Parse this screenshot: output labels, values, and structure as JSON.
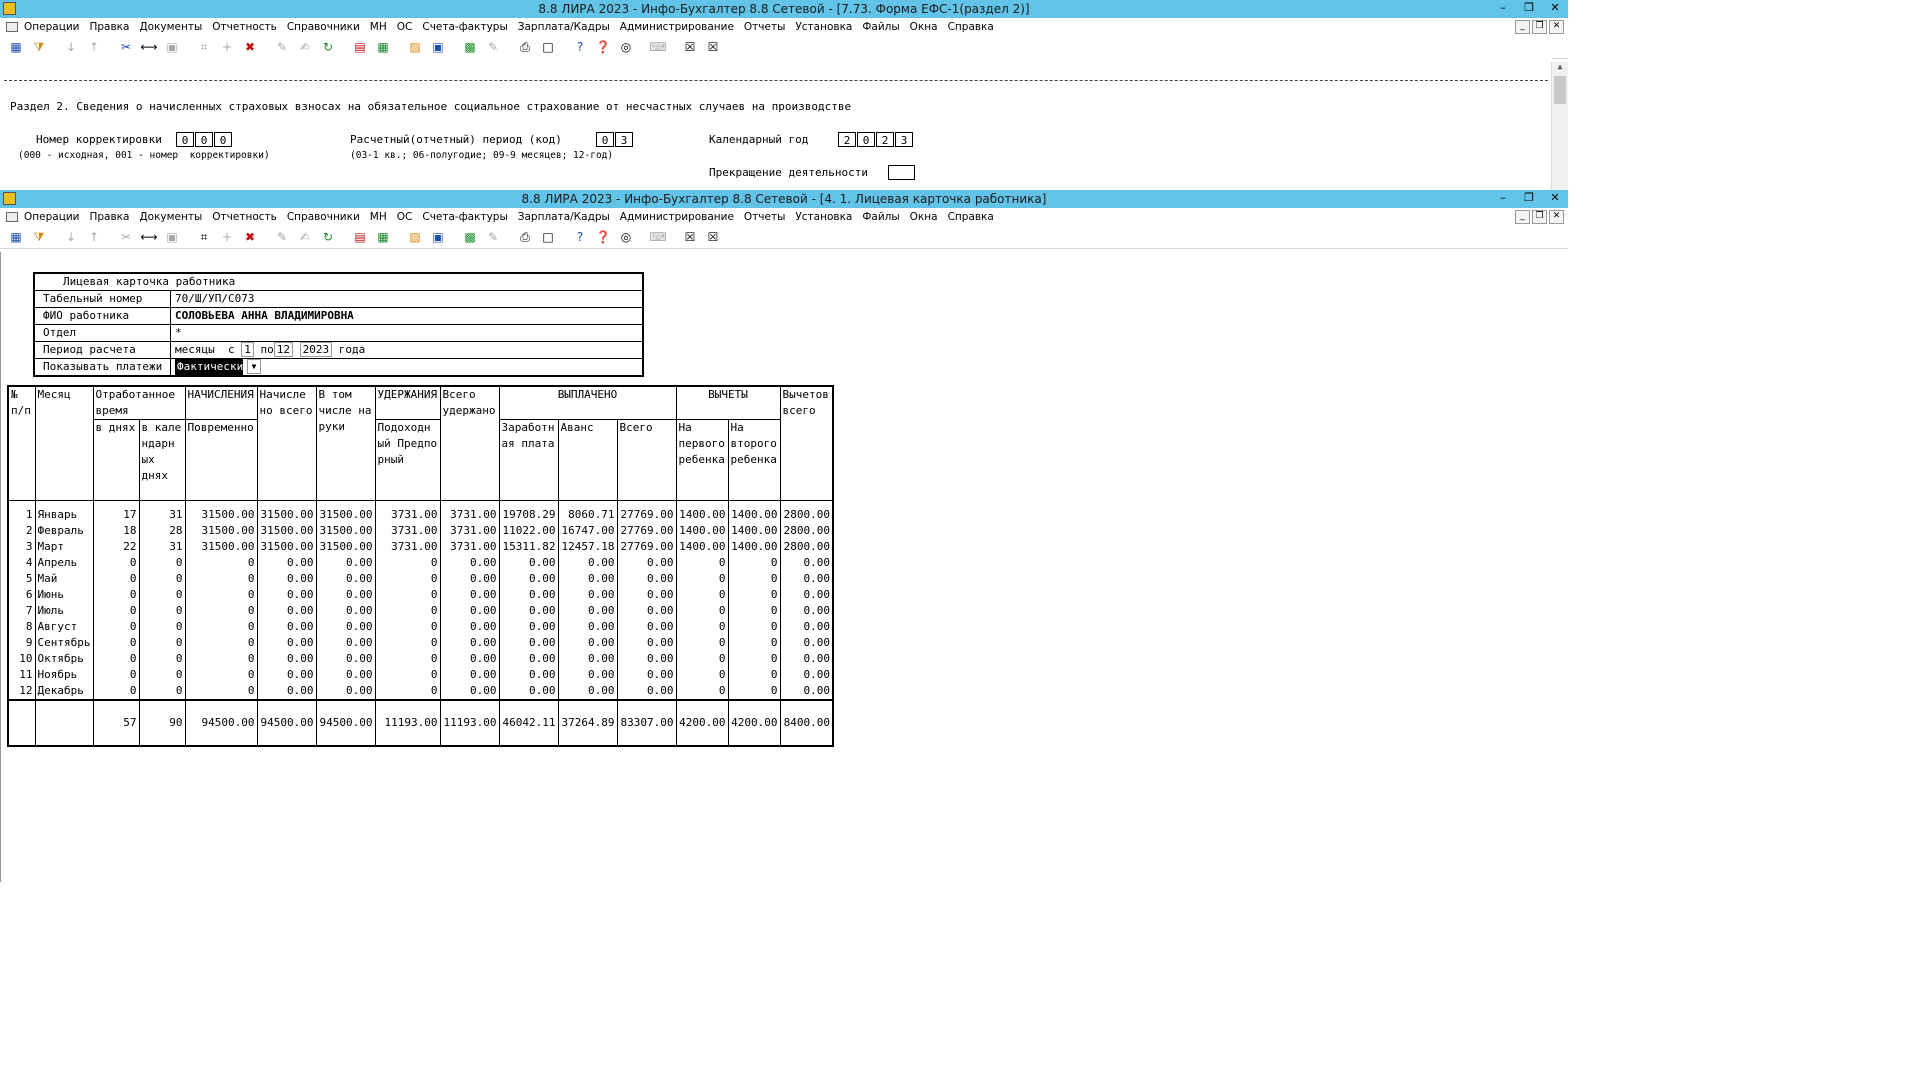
{
  "top_window": {
    "title": "8.8 ЛИРА 2023 - Инфо-Бухгалтер 8.8 Сетевой - [7.73.    Форма ЕФС-1(раздел 2)]",
    "section_heading": "Раздел 2. Сведения о начисленных страховых взносах на обязательное социальное страхование от несчастных случаев на производстве",
    "correction_label": "Номер корректировки",
    "correction_digits": [
      "0",
      "0",
      "0"
    ],
    "correction_hint": "(000 - исходная, 001 - номер  корректировки)",
    "period_label": "Расчетный(отчетный) период (код)",
    "period_digits": [
      "0",
      "3"
    ],
    "period_hint": "(03-1 кв.; 06-полугодие; 09-9 месяцев; 12-год)",
    "year_label": "Календарный год",
    "year_digits": [
      "2",
      "0",
      "2",
      "3"
    ],
    "termination_label": "Прекращение деятельности"
  },
  "main_window": {
    "title": "8.8 ЛИРА 2023 - Инфо-Бухгалтер 8.8 Сетевой - [4. 1. Лицевая карточка работника]"
  },
  "menu": [
    "Операции",
    "Правка",
    "Документы",
    "Отчетность",
    "Справочники",
    "МН",
    "ОС",
    "Счета-фактуры",
    "Зарплата/Кадры",
    "Администрирование",
    "Отчеты",
    "Установка",
    "Файлы",
    "Окна",
    "Справка"
  ],
  "card": {
    "title": "Лицевая карточка работника",
    "tab_label": "Табельный номер",
    "tab_value": "70/Ш/УП/С073",
    "fio_label": "ФИО работника",
    "fio_value": "СОЛОВЬЕВА АННА ВЛАДИМИРОВНА",
    "dept_label": "Отдел",
    "dept_value": "*",
    "period_label": "Период расчета",
    "period_months": "месяцы",
    "period_from_word": "с",
    "period_from": "1",
    "period_to_word": "по",
    "period_to": "12",
    "period_year": "2023",
    "period_year_word": "года",
    "payments_label": "Показывать платежи",
    "payments_value": "Фактически"
  },
  "table": {
    "headers": {
      "num": [
        "№",
        "п/п"
      ],
      "month": "Месяц",
      "worked": [
        "Отработанное",
        "время"
      ],
      "days": "в днях",
      "cal_days": [
        "в кале",
        "ндарн",
        "ых",
        "днях"
      ],
      "accruals_group": "НАЧИСЛЕНИЯ",
      "time_based": "Повременно",
      "accrued_total": [
        "Начисле",
        "но всего"
      ],
      "net": [
        "В том",
        "числе на",
        "руки"
      ],
      "withholdings_group": "УДЕРЖАНИЯ",
      "income_tax": [
        "Подоходн",
        "ый Предпо",
        "рный"
      ],
      "withheld_total": [
        "Всего",
        "удержано"
      ],
      "paid_group": "ВЫПЛАЧЕНО",
      "salary": [
        "Заработн",
        "ая плата"
      ],
      "advance": "Аванс",
      "paid_total": "Всего",
      "deductions_group": "ВЫЧЕТЫ",
      "first_child": [
        "На",
        "первого",
        "ребенка"
      ],
      "second_child": [
        "На",
        "второго",
        "ребенка"
      ],
      "deductions_total": [
        "Вычетов",
        "всего"
      ]
    },
    "rows": [
      [
        "1",
        "Январь",
        "17",
        "31",
        "31500.00",
        "31500.00",
        "31500.00",
        "3731.00",
        "3731.00",
        "19708.29",
        "8060.71",
        "27769.00",
        "1400.00",
        "1400.00",
        "2800.00"
      ],
      [
        "2",
        "Февраль",
        "18",
        "28",
        "31500.00",
        "31500.00",
        "31500.00",
        "3731.00",
        "3731.00",
        "11022.00",
        "16747.00",
        "27769.00",
        "1400.00",
        "1400.00",
        "2800.00"
      ],
      [
        "3",
        "Март",
        "22",
        "31",
        "31500.00",
        "31500.00",
        "31500.00",
        "3731.00",
        "3731.00",
        "15311.82",
        "12457.18",
        "27769.00",
        "1400.00",
        "1400.00",
        "2800.00"
      ],
      [
        "4",
        "Апрель",
        "0",
        "0",
        "0",
        "0.00",
        "0.00",
        "0",
        "0.00",
        "0.00",
        "0.00",
        "0.00",
        "0",
        "0",
        "0.00"
      ],
      [
        "5",
        "Май",
        "0",
        "0",
        "0",
        "0.00",
        "0.00",
        "0",
        "0.00",
        "0.00",
        "0.00",
        "0.00",
        "0",
        "0",
        "0.00"
      ],
      [
        "6",
        "Июнь",
        "0",
        "0",
        "0",
        "0.00",
        "0.00",
        "0",
        "0.00",
        "0.00",
        "0.00",
        "0.00",
        "0",
        "0",
        "0.00"
      ],
      [
        "7",
        "Июль",
        "0",
        "0",
        "0",
        "0.00",
        "0.00",
        "0",
        "0.00",
        "0.00",
        "0.00",
        "0.00",
        "0",
        "0",
        "0.00"
      ],
      [
        "8",
        "Август",
        "0",
        "0",
        "0",
        "0.00",
        "0.00",
        "0",
        "0.00",
        "0.00",
        "0.00",
        "0.00",
        "0",
        "0",
        "0.00"
      ],
      [
        "9",
        "Сентябрь",
        "0",
        "0",
        "0",
        "0.00",
        "0.00",
        "0",
        "0.00",
        "0.00",
        "0.00",
        "0.00",
        "0",
        "0",
        "0.00"
      ],
      [
        "10",
        "Октябрь",
        "0",
        "0",
        "0",
        "0.00",
        "0.00",
        "0",
        "0.00",
        "0.00",
        "0.00",
        "0.00",
        "0",
        "0",
        "0.00"
      ],
      [
        "11",
        "Ноябрь",
        "0",
        "0",
        "0",
        "0.00",
        "0.00",
        "0",
        "0.00",
        "0.00",
        "0.00",
        "0.00",
        "0",
        "0",
        "0.00"
      ],
      [
        "12",
        "Декабрь",
        "0",
        "0",
        "0",
        "0.00",
        "0.00",
        "0",
        "0.00",
        "0.00",
        "0.00",
        "0.00",
        "0",
        "0",
        "0.00"
      ]
    ],
    "totals": [
      "",
      "",
      "57",
      "90",
      "94500.00",
      "94500.00",
      "94500.00",
      "11193.00",
      "11193.00",
      "46042.11",
      "37264.89",
      "83307.00",
      "4200.00",
      "4200.00",
      "8400.00"
    ]
  },
  "toolbar_icons": [
    "table-view-icon",
    "filter-icon",
    "sort-asc-icon",
    "sort-desc-icon",
    "cut-icon",
    "column-width-icon",
    "paste-icon",
    "number-format-icon",
    "add-icon",
    "delete-icon",
    "mark-icon",
    "mark-all-icon",
    "refresh-icon",
    "pdf-icon",
    "calculator-icon",
    "open-folder-icon",
    "save-icon",
    "excel-icon",
    "edit-icon",
    "print-icon",
    "preview-icon",
    "help-icon",
    "context-help-icon",
    "compass-icon",
    "keyboard-icon",
    "close-doc-icon",
    "close-all-icon"
  ],
  "colors": {
    "titlebar": "#62c3e8",
    "select_bg": "#000000"
  }
}
